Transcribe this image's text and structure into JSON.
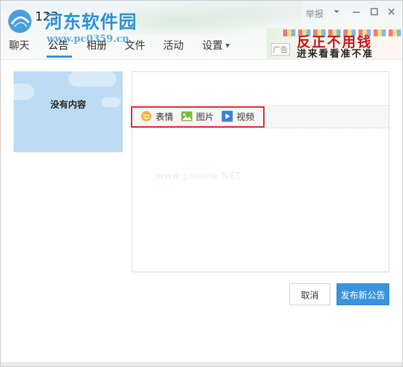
{
  "header": {
    "group_name": "123",
    "watermark_title": "河东软件园",
    "watermark_url": "www.pc0359.cn",
    "report_label": "举报",
    "tabs": [
      {
        "label": "聊天"
      },
      {
        "label": "公告"
      },
      {
        "label": "相册"
      },
      {
        "label": "文件"
      },
      {
        "label": "活动"
      },
      {
        "label": "设置"
      }
    ],
    "active_tab": "公告",
    "ad": {
      "badge": "广告",
      "line1": "反正不用钱",
      "line2": "进来看看准不准"
    }
  },
  "sidebar": {
    "empty_text": "没有内容"
  },
  "editor": {
    "title_value": "",
    "body_value": "",
    "body_watermark": "www.pHome.NET",
    "toolbar": [
      {
        "label": "表情",
        "icon": "smiley-icon"
      },
      {
        "label": "图片",
        "icon": "image-icon"
      },
      {
        "label": "视频",
        "icon": "video-play-icon"
      }
    ]
  },
  "actions": {
    "cancel_label": "取消",
    "publish_label": "发布新公告"
  },
  "colors": {
    "accent": "#3a94dc",
    "tab_underline": "#2d8fe3",
    "highlight_box": "#d6262b",
    "watermark": "#2b8fd6"
  }
}
